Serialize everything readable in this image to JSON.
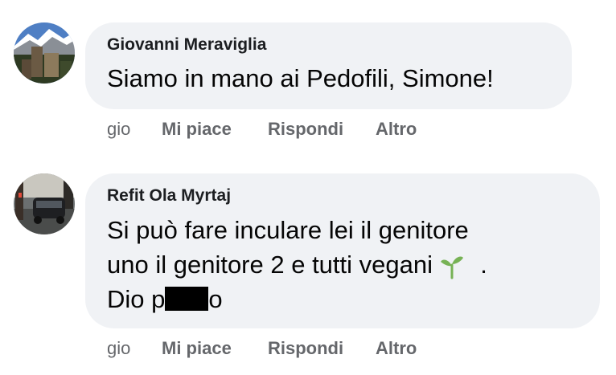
{
  "comments": [
    {
      "author": "Giovanni Meraviglia",
      "lines": [
        "Siamo in mano ai Pedofili, Simone!"
      ],
      "time": "gio",
      "like_label": "Mi piace",
      "reply_label": "Rispondi",
      "more_label": "Altro",
      "avatar_icon": "mountain-town-photo"
    },
    {
      "author": "Refit Ola Myrtaj",
      "lines": [
        "Si può fare inculare lei il genitore",
        "uno il genitore 2 e tutti vegani",
        "."
      ],
      "line3_prefix": "Dio p",
      "line3_suffix": "o",
      "emoji_icon": "seedling-icon",
      "redacted": true,
      "time": "gio",
      "like_label": "Mi piace",
      "reply_label": "Rispondi",
      "more_label": "Altro",
      "avatar_icon": "car-street-photo"
    }
  ],
  "colors": {
    "bubble": "#f0f2f5",
    "meta": "#65676b",
    "text": "#050505",
    "emoji": "#77b255"
  }
}
